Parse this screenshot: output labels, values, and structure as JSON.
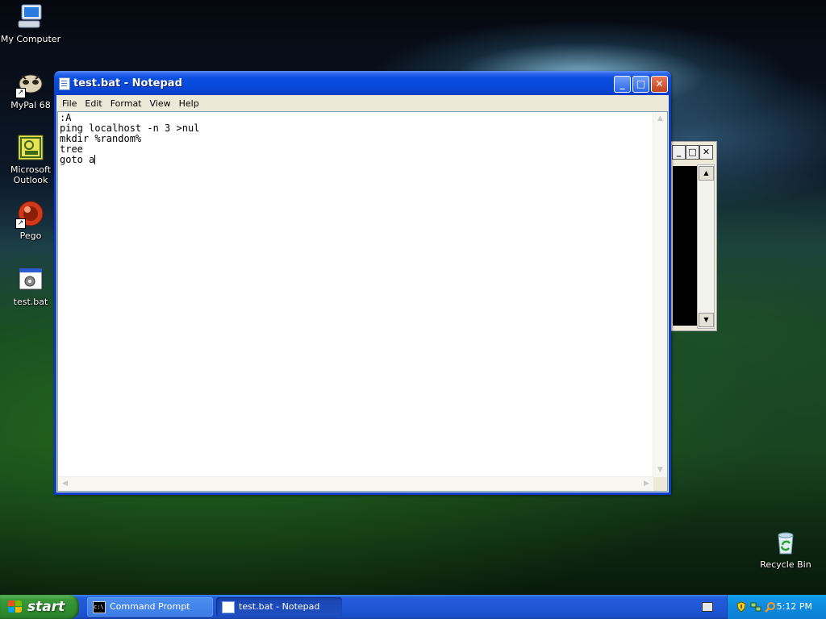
{
  "desktop": {
    "icons": [
      {
        "label": "My Computer"
      },
      {
        "label": "MyPal 68"
      },
      {
        "label": "Microsoft Outlook"
      },
      {
        "label": "Pego"
      },
      {
        "label": "test.bat"
      },
      {
        "label": "Recycle Bin"
      }
    ]
  },
  "notepad": {
    "title": "test.bat - Notepad",
    "menu": [
      "File",
      "Edit",
      "Format",
      "View",
      "Help"
    ],
    "lines": [
      ":A",
      "ping localhost -n 3 >nul",
      "mkdir %random%",
      "tree",
      "goto a"
    ],
    "controls": {
      "minimize": "_",
      "maximize": "□",
      "close": "✕"
    }
  },
  "console": {
    "controls": {
      "minimize": "_",
      "maximize": "□",
      "close": "✕"
    }
  },
  "taskbar": {
    "start_label": "start",
    "tasks": [
      {
        "label": "Command Prompt",
        "active": false
      },
      {
        "label": "test.bat - Notepad",
        "active": true
      }
    ],
    "clock": "5:12 PM"
  },
  "colors": {
    "title_blue": "#0a4ee0",
    "start_green": "#3a9a3a",
    "tray_blue": "#0f8ce0"
  }
}
